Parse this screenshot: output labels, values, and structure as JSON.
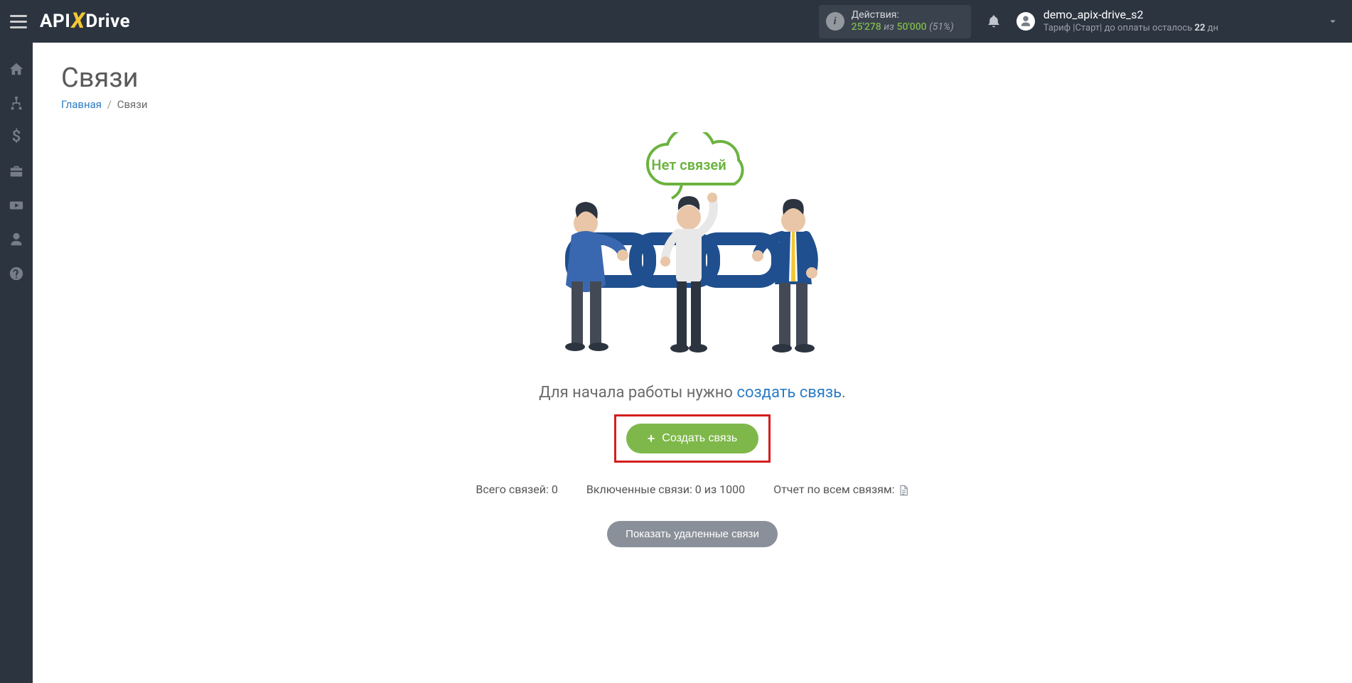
{
  "header": {
    "logo_api": "API",
    "logo_x": "X",
    "logo_drive": "Drive",
    "actions_label": "Действия:",
    "actions_used": "25'278",
    "actions_iz": "из",
    "actions_total": "50'000",
    "actions_pct": "(51%)",
    "user_name": "demo_apix-drive_s2",
    "user_tariff_prefix": "Тариф |Старт| до оплаты осталось ",
    "user_tariff_days": "22",
    "user_tariff_suffix": " дн"
  },
  "page": {
    "title": "Связи",
    "breadcrumb_home": "Главная",
    "breadcrumb_current": "Связи"
  },
  "empty": {
    "cloud_text": "Нет связей",
    "prompt_text_before": "Для начала работы нужно ",
    "prompt_link": "создать связь",
    "prompt_text_after": ".",
    "create_button": "Создать связь"
  },
  "stats": {
    "total_label": "Всего связей: ",
    "total_value": "0",
    "enabled_label": "Включенные связи: ",
    "enabled_value": "0 из 1000",
    "report_label": "Отчет по всем связям: "
  },
  "footer": {
    "show_deleted": "Показать удаленные связи"
  }
}
